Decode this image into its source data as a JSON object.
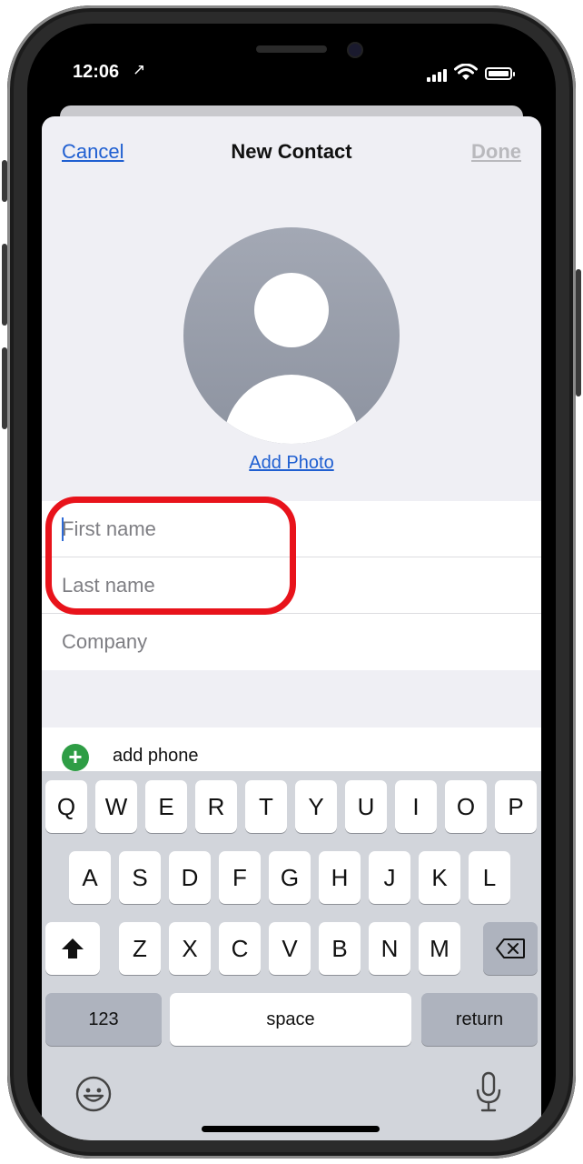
{
  "status_bar": {
    "time": "12:06",
    "location_glyph": "↗"
  },
  "nav": {
    "cancel": "Cancel",
    "title": "New Contact",
    "done": "Done"
  },
  "photo": {
    "add_label": "Add Photo"
  },
  "fields": {
    "first_name_placeholder": "First name",
    "last_name_placeholder": "Last name",
    "company_placeholder": "Company",
    "first_name_value": "",
    "last_name_value": "",
    "company_value": ""
  },
  "add_phone": {
    "icon": "plus",
    "label": "add phone"
  },
  "keyboard": {
    "row1": [
      "Q",
      "W",
      "E",
      "R",
      "T",
      "Y",
      "U",
      "I",
      "O",
      "P"
    ],
    "row2": [
      "A",
      "S",
      "D",
      "F",
      "G",
      "H",
      "J",
      "K",
      "L"
    ],
    "row3": [
      "Z",
      "X",
      "C",
      "V",
      "B",
      "N",
      "M"
    ],
    "numbers": "123",
    "space": "space",
    "return": "return"
  },
  "colors": {
    "accent": "#1f5fd1",
    "highlight": "#e8131b",
    "add_green": "#2e9d45"
  }
}
